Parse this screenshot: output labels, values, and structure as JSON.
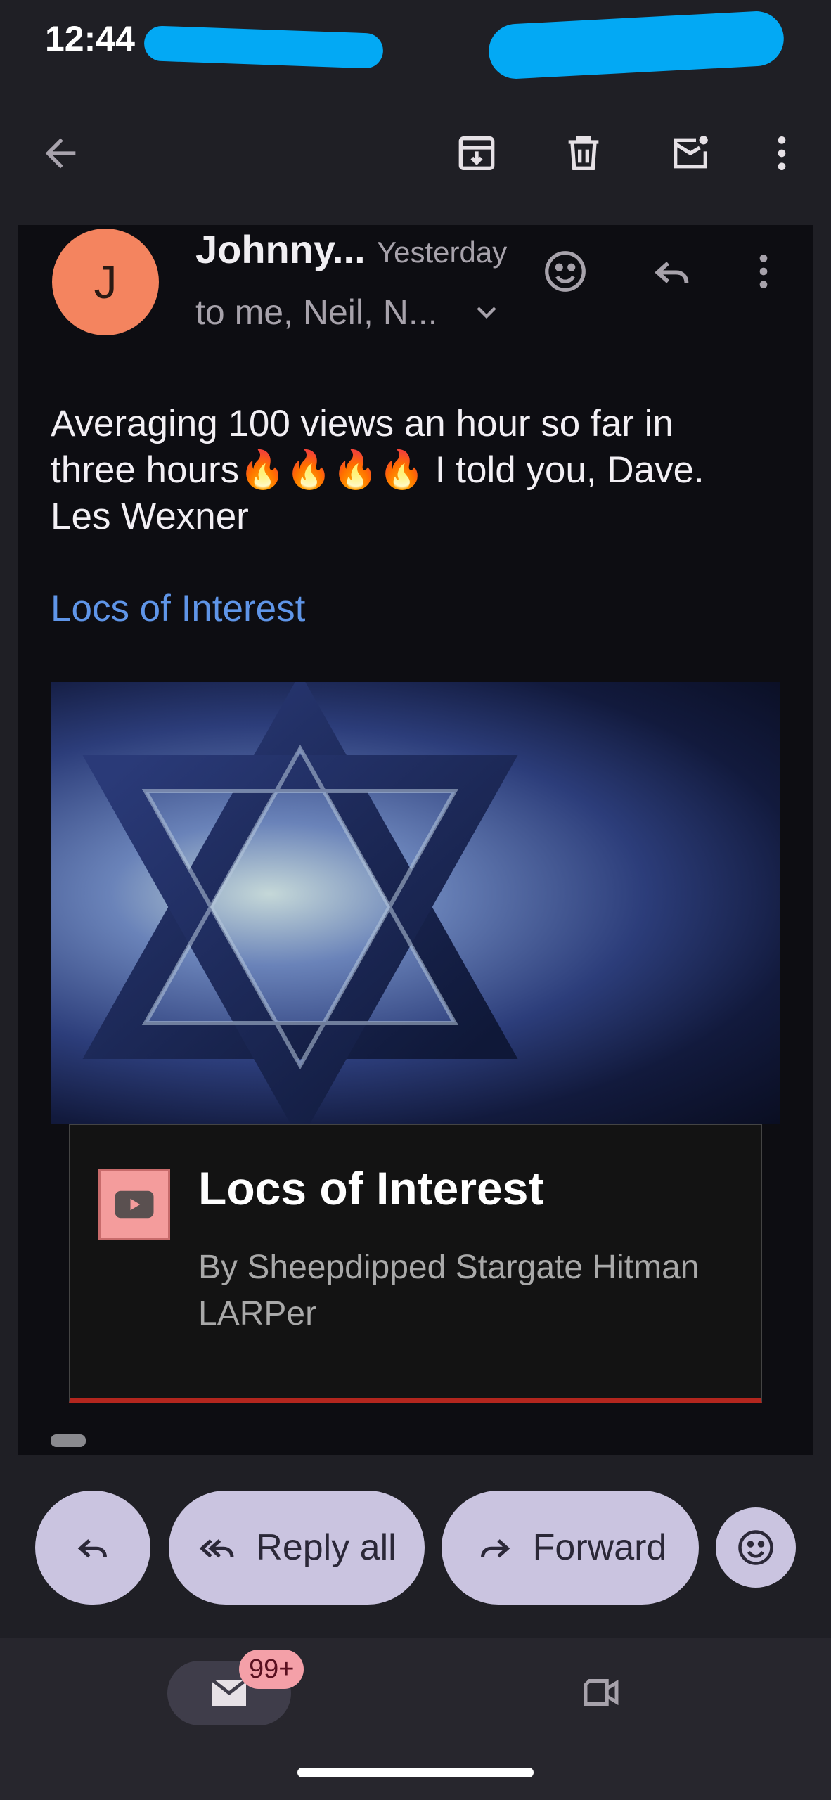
{
  "status_bar": {
    "time": "12:44"
  },
  "app_bar": {
    "icons": [
      "back-arrow-icon",
      "archive-icon",
      "delete-icon",
      "mark-unread-icon",
      "more-vert-icon"
    ]
  },
  "message": {
    "avatar_initial": "J",
    "sender": "Johnny...",
    "timestamp": "Yesterday",
    "recipients": "to me, Neil, N...",
    "body": "Averaging 100 views an hour so far in three hours🔥🔥🔥🔥 I told you, Dave. Les Wexner",
    "link_text": "Locs of Interest",
    "preview": {
      "title": "Locs of Interest",
      "byline": "By Sheepdipped Stargate Hitman LARPer"
    }
  },
  "actions": {
    "reply_all": "Reply all",
    "forward": "Forward"
  },
  "bottom_nav": {
    "mail_badge": "99+"
  },
  "colors": {
    "background": "#1f1f25",
    "card": "#0d0d12",
    "avatar": "#f4845f",
    "link": "#5f95e8",
    "pill": "#cac4e0",
    "badge": "#f4a0a8",
    "redact_scribble": "#03a9f4"
  }
}
